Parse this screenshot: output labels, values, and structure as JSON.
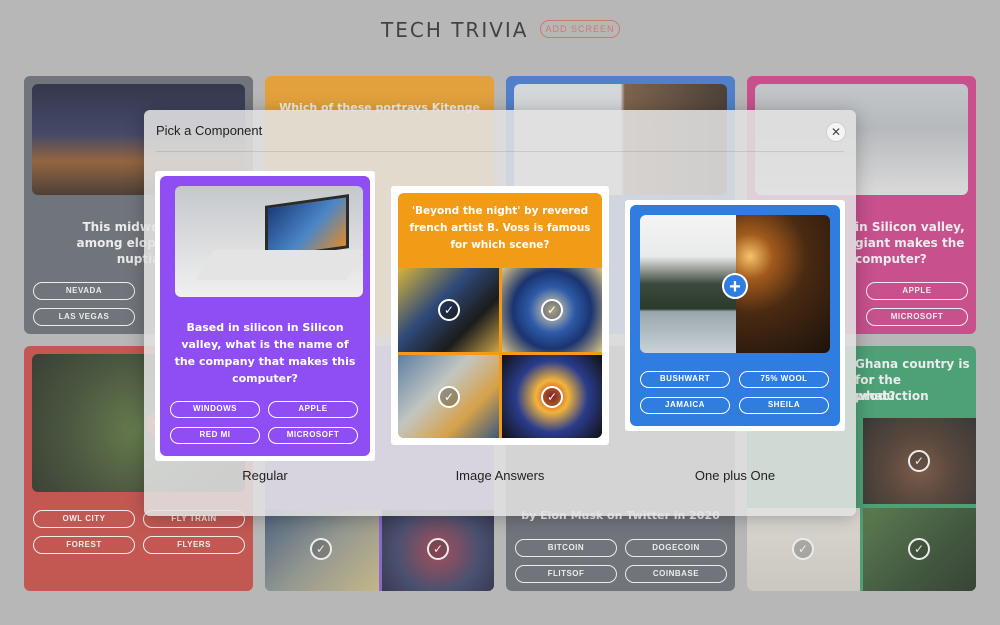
{
  "header": {
    "title": "TECH TRIVIA",
    "add_screen_label": "ADD SCREEN"
  },
  "colors": {
    "red": "#c93a33",
    "purple": "#8f4ef3",
    "orange": "#f29b16",
    "blue": "#2f7de1",
    "magenta": "#cf2f81",
    "gray": "#5a5f69",
    "green": "#2c9a63"
  },
  "background_cards": {
    "card1": {
      "question": "This midwestern ... among elopers for nuptia...",
      "line1": "This midwestern",
      "line2": "among elopers for",
      "line3": "nuptia",
      "options": [
        "NEVADA",
        "LAS VEGAS"
      ]
    },
    "card2": {
      "question_fragment": "Which of these portrays Kitenge"
    },
    "card4": {
      "line1": "in Silicon valley,",
      "line2": "giant makes the",
      "line3": "computer?",
      "options": [
        "APPLE",
        "MICROSOFT"
      ]
    },
    "card5": {
      "options": [
        "OWL CITY",
        "FLY TRAIN",
        "FOREST",
        "FLYERS"
      ]
    },
    "card7": {
      "fragment": "by Elon Musk on Twitter in 2020",
      "options": [
        "BITCOIN",
        "DOGECOIN",
        "FLITSOF",
        "COINBASE"
      ]
    },
    "card8": {
      "line1": "Ghana country is",
      "line2": "for the production",
      "line3": "what?"
    }
  },
  "modal": {
    "title": "Pick a Component",
    "close_icon": "close-icon",
    "options": [
      {
        "label": "Regular",
        "question": "Based in silicon in Silicon valley, what is the name of the company that makes this computer?",
        "answers": [
          "WINDOWS",
          "APPLE",
          "RED MI",
          "MICROSOFT"
        ]
      },
      {
        "label": "Image Answers",
        "question": "'Beyond the night' by revered french artist B. Voss is famous for which scene?"
      },
      {
        "label": "One plus One",
        "answers": [
          "BUSHWART",
          "75% WOOL",
          "JAMAICA",
          "SHEILA"
        ]
      }
    ]
  }
}
